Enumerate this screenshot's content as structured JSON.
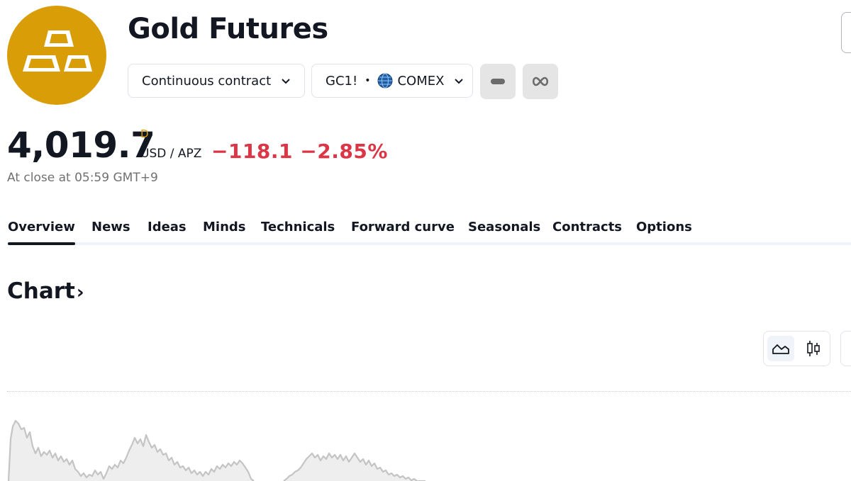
{
  "header": {
    "title": "Gold Futures",
    "contract_selector": "Continuous contract",
    "symbol": "GC1!",
    "separator": "•",
    "exchange": "COMEX",
    "logo_icon": "gold-bars-icon",
    "brand_color": "#D89D07"
  },
  "quote": {
    "price": "4,019.7",
    "badge": "D",
    "currency": "USD / APZ",
    "change": "−118.1",
    "change_percent": "−2.85%",
    "change_color": "#dc3545",
    "close_info": "At close at 05:59 GMT+9"
  },
  "tabs": [
    {
      "label": "Overview",
      "active": true
    },
    {
      "label": "News"
    },
    {
      "label": "Ideas"
    },
    {
      "label": "Minds"
    },
    {
      "label": "Technicals"
    },
    {
      "label": "Forward curve"
    },
    {
      "label": "Seasonals"
    },
    {
      "label": "Contracts"
    },
    {
      "label": "Options"
    }
  ],
  "chart_section": {
    "title": "Chart",
    "arrow": "›",
    "chart_types": [
      "area-chart-icon",
      "candles-icon"
    ]
  }
}
